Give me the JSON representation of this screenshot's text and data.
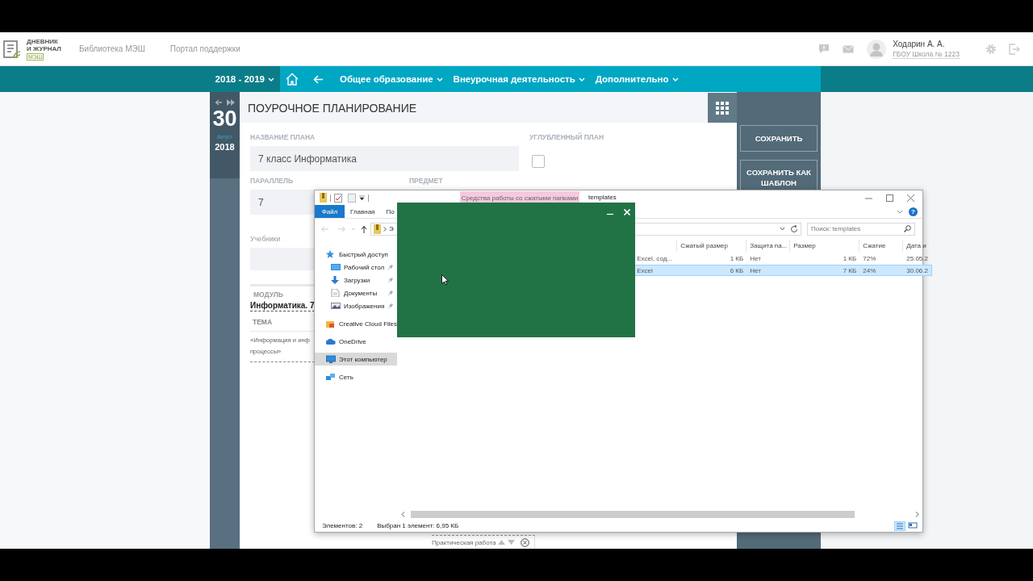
{
  "header": {
    "logo": {
      "lines": [
        "ДНЕВНИК",
        "И ЖУРНАЛ"
      ],
      "badge": "МЭШ"
    },
    "links": [
      "Библиотека МЭШ",
      "Портал поддержки"
    ],
    "user": {
      "name": "Ходарин А. А.",
      "school": "ГБОУ Школа № 1223"
    }
  },
  "nav": {
    "year": "2018 - 2019",
    "menus": [
      "Общее образование",
      "Внеурочная деятельность",
      "Дополнительно"
    ]
  },
  "date_panel": {
    "day": "30",
    "month": "Август",
    "year": "2018"
  },
  "page": {
    "title": "ПОУРОЧНОЕ ПЛАНИРОВАНИЕ",
    "plan_name": {
      "label": "НАЗВАНИЕ ПЛАНА",
      "value": "7 класс Информатика"
    },
    "deep_plan": {
      "label": "УГЛУБЛЕННЫЙ ПЛАН",
      "checked": false
    },
    "parallel": {
      "label": "ПАРАЛЛЕЛЬ",
      "value": "7"
    },
    "subject": {
      "label": "ПРЕДМЕТ"
    },
    "textbooks": {
      "label": "Учебники"
    },
    "module": {
      "label": "МОДУЛЬ",
      "value": "Информатика. 7"
    },
    "topic": {
      "label": "ТЕМА",
      "lines": [
        "«Информация и инф",
        "процессы»"
      ]
    },
    "lesson_row": {
      "label": "Практическая работа"
    }
  },
  "actions": [
    "СОХРАНИТЬ",
    "СОХРАНИТЬ КАК ШАБЛОН"
  ],
  "explorer": {
    "context_tab": "Средства работы со сжатыми папками",
    "title": "templates",
    "ribbon_tabs": [
      {
        "label": "Файл",
        "selected": true
      },
      {
        "label": "Главная",
        "selected": false
      },
      {
        "label": "По",
        "selected": false
      }
    ],
    "help": "?",
    "address": "Э",
    "search": {
      "placeholder": "Поиск: templates"
    },
    "nav_items": [
      {
        "label": "Быстрый доступ",
        "selected": false,
        "children": [
          {
            "label": "Рабочий стол",
            "selected": false,
            "pinned": true
          },
          {
            "label": "Загрузки",
            "selected": false,
            "pinned": true
          },
          {
            "label": "Документы",
            "selected": false,
            "pinned": true
          },
          {
            "label": "Изображения",
            "selected": false,
            "pinned": true
          }
        ]
      },
      {
        "label": "Creative Cloud Files",
        "selected": false
      },
      {
        "label": "OneDrive",
        "selected": false
      },
      {
        "label": "Этот компьютер",
        "selected": true
      },
      {
        "label": "Сеть",
        "selected": false
      }
    ],
    "columns": [
      "",
      "Сжатый размер",
      "Защита па...",
      "Размер",
      "Сжатие",
      "Дата и"
    ],
    "rows": [
      {
        "cells": [
          "Excel, сод...",
          "1 КБ",
          "Нет",
          "1 КБ",
          "72%",
          "25.05.2"
        ],
        "selected": false
      },
      {
        "cells": [
          "Excel",
          "6 КБ",
          "Нет",
          "7 КБ",
          "24%",
          "30.06.2"
        ],
        "selected": true
      }
    ],
    "status": [
      "Элементов: 2",
      "Выбран 1 элемент: 6,95 КБ"
    ]
  }
}
